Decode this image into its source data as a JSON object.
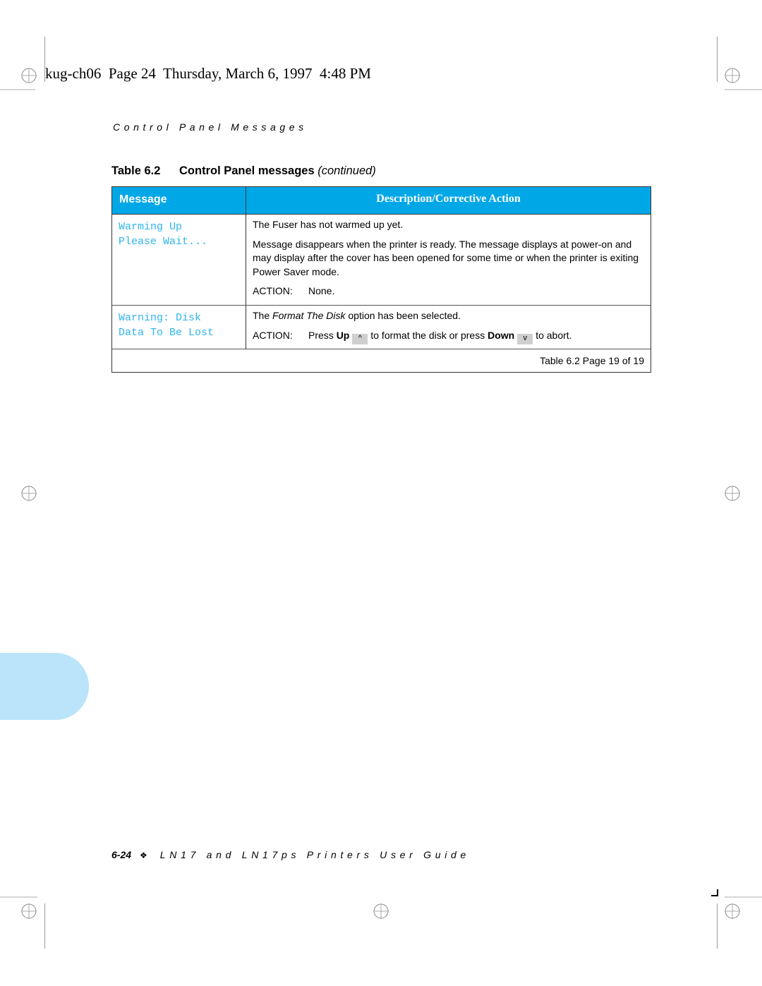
{
  "page_header": "kug-ch06  Page 24  Thursday, March 6, 1997  4:48 PM",
  "running_head": "Control Panel Messages",
  "table": {
    "number": "Table 6.2",
    "title": "Control Panel messages",
    "continued": "(continued)",
    "columns": [
      "Message",
      "Description/Corrective Action"
    ],
    "rows": [
      {
        "message_lines": [
          "Warming Up",
          "Please Wait..."
        ],
        "description": [
          "The Fuser has not warmed up yet.",
          "Message disappears when the printer is ready. The message displays at power-on and may display after the cover has been opened for some time or when the printer is exiting Power Saver mode."
        ],
        "action_label": "ACTION:",
        "action_text": "None."
      },
      {
        "message_lines": [
          "Warning: Disk",
          "Data To Be Lost"
        ],
        "description_prefix": "The ",
        "description_italic": "Format The Disk",
        "description_suffix": " option has been selected.",
        "action_label": "ACTION:",
        "action_press": "Press",
        "action_up": "Up",
        "up_key_icon": "^",
        "action_middle": "to format the disk or press",
        "action_down": "Down",
        "down_key_icon": "v",
        "action_end": "to abort."
      }
    ],
    "footer": "Table 6.2  Page 19 of 19"
  },
  "page_footer": {
    "page_number": "6-24",
    "separator": "❖",
    "guide_title": "LN17 and LN17ps Printers User Guide"
  },
  "colors": {
    "header_bg": "#00a7e7",
    "lcd_text": "#2fb4ee",
    "thumb_tab": "#b9e4f9"
  }
}
